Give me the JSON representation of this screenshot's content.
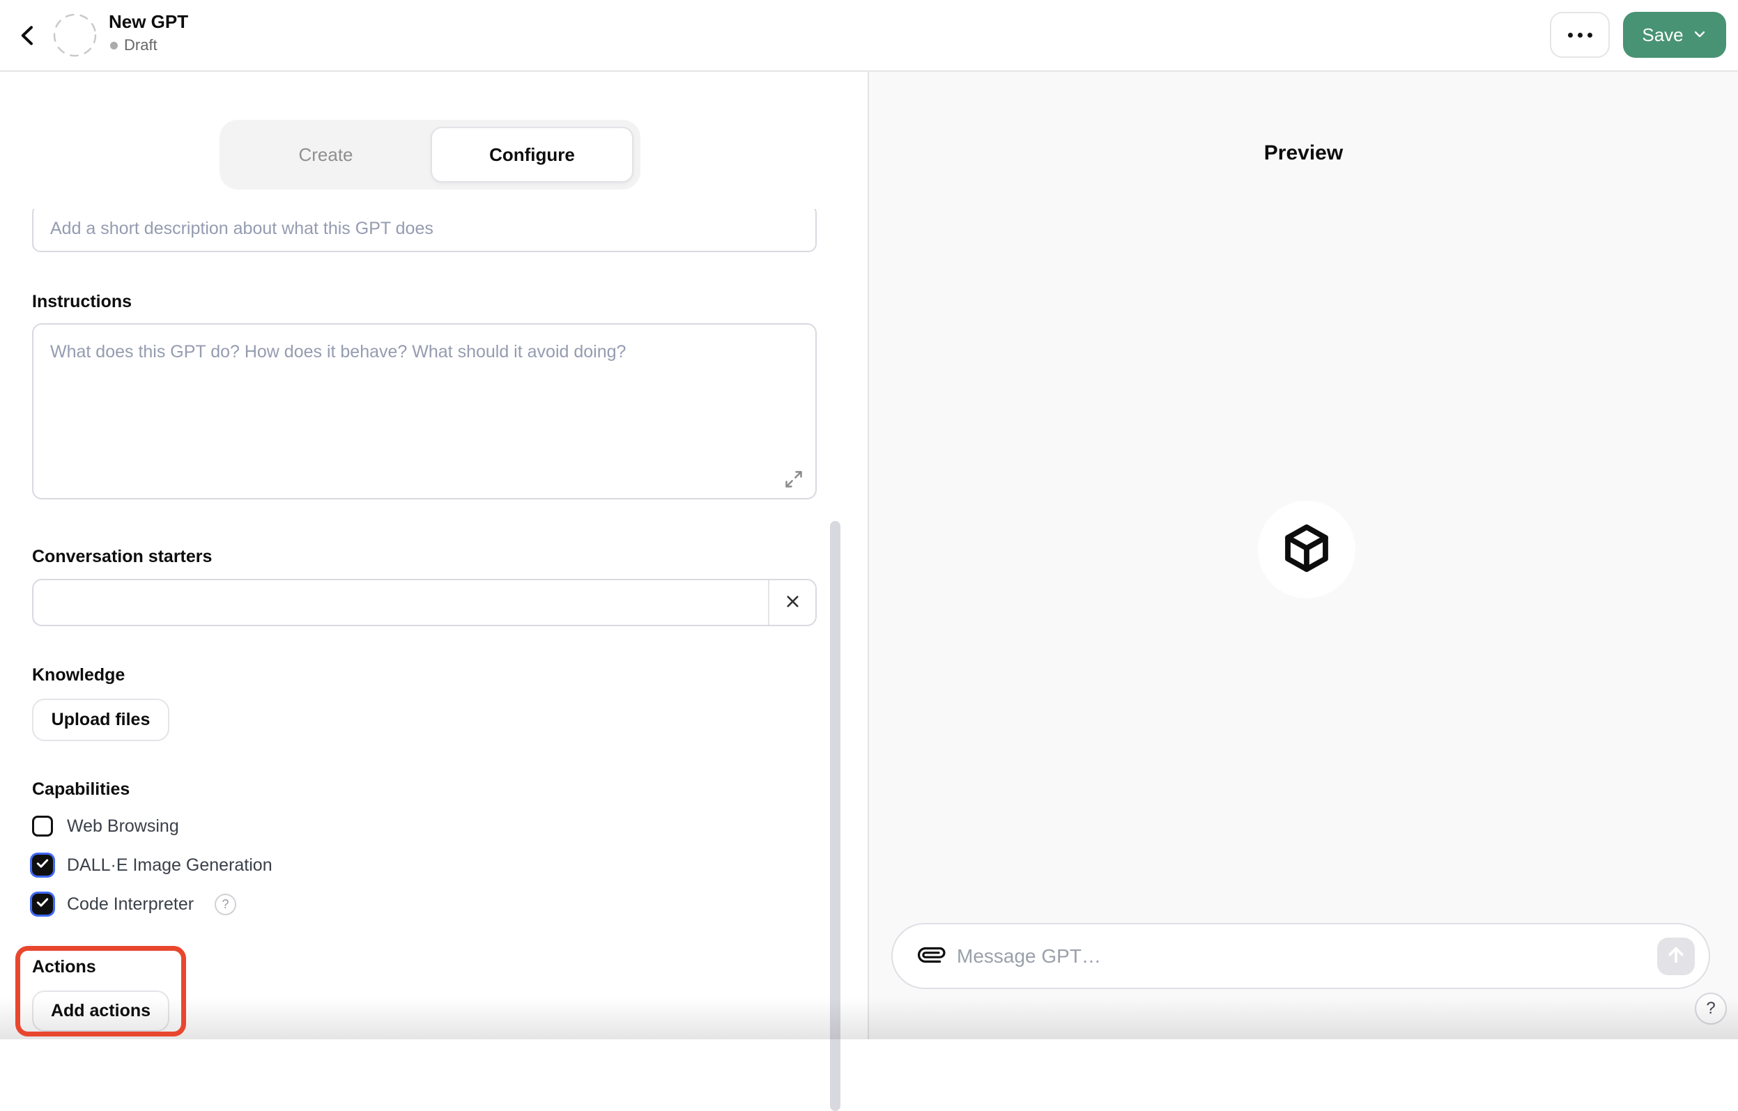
{
  "header": {
    "back_icon": "chevron-left",
    "avatar_icon": "dashed-circle-placeholder",
    "title": "New GPT",
    "status": "Draft",
    "more_button": "•••",
    "save_button": {
      "label": "Save",
      "icon": "chevron-down"
    }
  },
  "tabs": {
    "create_label": "Create",
    "configure_label": "Configure",
    "active": "Configure"
  },
  "form": {
    "description": {
      "value": "",
      "placeholder": "Add a short description about what this GPT does"
    },
    "instructions": {
      "label": "Instructions",
      "value": "",
      "placeholder": "What does this GPT do? How does it behave? What should it avoid doing?",
      "expand_icon": "expand-diagonal-arrows"
    },
    "conversation_starters": {
      "label": "Conversation starters",
      "items": [
        {
          "value": "",
          "remove_icon": "x"
        }
      ]
    },
    "knowledge": {
      "label": "Knowledge",
      "upload_button": "Upload files"
    },
    "capabilities": {
      "label": "Capabilities",
      "items": [
        {
          "label": "Web Browsing",
          "checked": false
        },
        {
          "label": "DALL·E Image Generation",
          "checked": true
        },
        {
          "label": "Code Interpreter",
          "checked": true,
          "help_icon": "?"
        }
      ]
    },
    "actions": {
      "label": "Actions",
      "add_button": "Add actions",
      "annotated_with_red_box": true
    }
  },
  "preview": {
    "title": "Preview",
    "avatar_icon": "cube",
    "composer": {
      "attach_icon": "paperclip",
      "placeholder": "Message GPT…",
      "value": "",
      "send_icon": "arrow-up"
    },
    "help_button": "?"
  },
  "colors": {
    "save_green": "#489374",
    "annotation_red": "#e8472e",
    "right_panel_bg": "#f9f9f9",
    "checkbox_checked": "#0f0f0f",
    "focus_ring_blue": "#3f6af5"
  }
}
